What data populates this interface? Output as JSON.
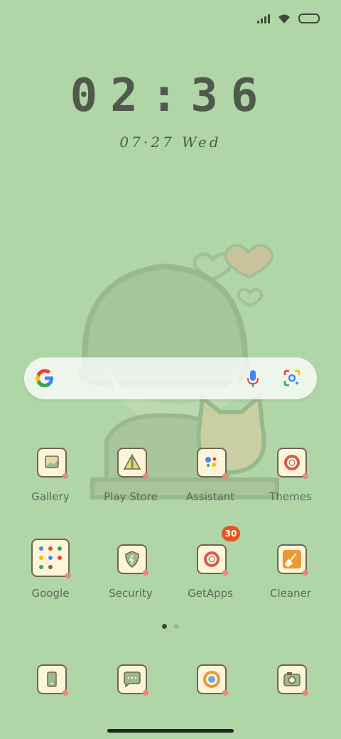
{
  "status_bar": {
    "signal_icon": "cell-signal-icon",
    "wifi_icon": "wifi-icon",
    "battery_icon": "battery-icon"
  },
  "clock": {
    "time": "02:36",
    "date": "07·27 Wed"
  },
  "search": {
    "google_icon": "google-g-icon",
    "mic_icon": "mic-icon",
    "lens_icon": "lens-icon"
  },
  "apps": {
    "row1": [
      {
        "label": "Gallery",
        "icon": "gallery-icon"
      },
      {
        "label": "Play Store",
        "icon": "play-store-icon"
      },
      {
        "label": "Assistant",
        "icon": "assistant-icon"
      },
      {
        "label": "Themes",
        "icon": "themes-icon"
      }
    ],
    "row2": [
      {
        "label": "Google",
        "icon": "google-folder-icon"
      },
      {
        "label": "Security",
        "icon": "security-icon"
      },
      {
        "label": "GetApps",
        "icon": "getapps-icon",
        "badge": "30"
      },
      {
        "label": "Cleaner",
        "icon": "cleaner-icon"
      }
    ]
  },
  "dock": [
    {
      "icon": "phone-icon"
    },
    {
      "icon": "messages-icon"
    },
    {
      "icon": "browser-icon"
    },
    {
      "icon": "camera-icon"
    }
  ],
  "page_indicator": {
    "pages": 2,
    "active": 1
  },
  "colors": {
    "background": "#b0d5a7",
    "text": "#5c6b58",
    "badge": "#e8541f"
  }
}
